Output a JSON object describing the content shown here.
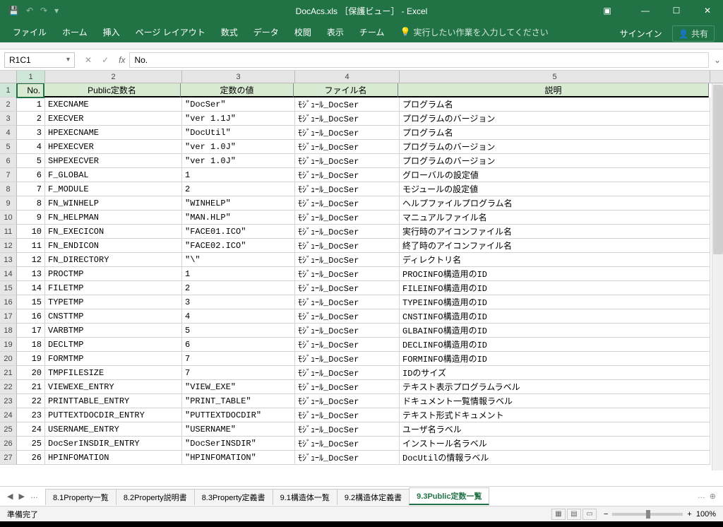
{
  "title": "DocAcs.xls ［保護ビュー］ - Excel",
  "ribbonTabs": [
    "ファイル",
    "ホーム",
    "挿入",
    "ページ レイアウト",
    "数式",
    "データ",
    "校閲",
    "表示",
    "チーム"
  ],
  "tellme": "実行したい作業を入力してください",
  "signin": "サインイン",
  "share": "共有",
  "nameBox": "R1C1",
  "fxValue": "No.",
  "colHeaders": [
    "1",
    "2",
    "3",
    "4",
    "5"
  ],
  "tableHeaders": [
    "No.",
    "Public定数名",
    "定数の値",
    "ファイル名",
    "説明"
  ],
  "rows": [
    {
      "n": "1",
      "name": "EXECNAME",
      "val": "\"DocSer\"",
      "file": "ﾓｼﾞｭｰﾙ_DocSer",
      "desc": "プログラム名"
    },
    {
      "n": "2",
      "name": "EXECVER",
      "val": "\"ver 1.1J\"",
      "file": "ﾓｼﾞｭｰﾙ_DocSer",
      "desc": "プログラムのバージョン"
    },
    {
      "n": "3",
      "name": "HPEXECNAME",
      "val": "\"DocUtil\"",
      "file": "ﾓｼﾞｭｰﾙ_DocSer",
      "desc": "プログラム名"
    },
    {
      "n": "4",
      "name": "HPEXECVER",
      "val": "\"ver 1.0J\"",
      "file": "ﾓｼﾞｭｰﾙ_DocSer",
      "desc": "プログラムのバージョン"
    },
    {
      "n": "5",
      "name": "SHPEXECVER",
      "val": "\"ver 1.0J\"",
      "file": "ﾓｼﾞｭｰﾙ_DocSer",
      "desc": "プログラムのバージョン"
    },
    {
      "n": "6",
      "name": "F_GLOBAL",
      "val": "1",
      "file": "ﾓｼﾞｭｰﾙ_DocSer",
      "desc": "グローバルの設定値"
    },
    {
      "n": "7",
      "name": "F_MODULE",
      "val": "2",
      "file": "ﾓｼﾞｭｰﾙ_DocSer",
      "desc": "モジュールの設定値"
    },
    {
      "n": "8",
      "name": "FN_WINHELP",
      "val": "\"WINHELP\"",
      "file": "ﾓｼﾞｭｰﾙ_DocSer",
      "desc": "ヘルプファイルプログラム名"
    },
    {
      "n": "9",
      "name": "FN_HELPMAN",
      "val": "\"MAN.HLP\"",
      "file": "ﾓｼﾞｭｰﾙ_DocSer",
      "desc": "マニュアルファイル名"
    },
    {
      "n": "10",
      "name": "FN_EXECICON",
      "val": "\"FACE01.ICO\"",
      "file": "ﾓｼﾞｭｰﾙ_DocSer",
      "desc": "実行時のアイコンファイル名"
    },
    {
      "n": "11",
      "name": "FN_ENDICON",
      "val": "\"FACE02.ICO\"",
      "file": "ﾓｼﾞｭｰﾙ_DocSer",
      "desc": "終了時のアイコンファイル名"
    },
    {
      "n": "12",
      "name": "FN_DIRECTORY",
      "val": "\"\\\"",
      "file": "ﾓｼﾞｭｰﾙ_DocSer",
      "desc": "ディレクトリ名"
    },
    {
      "n": "13",
      "name": "PROCTMP",
      "val": "1",
      "file": "ﾓｼﾞｭｰﾙ_DocSer",
      "desc": "PROCINFO構造用のID"
    },
    {
      "n": "14",
      "name": "FILETMP",
      "val": "2",
      "file": "ﾓｼﾞｭｰﾙ_DocSer",
      "desc": "FILEINFO構造用のID"
    },
    {
      "n": "15",
      "name": "TYPETMP",
      "val": "3",
      "file": "ﾓｼﾞｭｰﾙ_DocSer",
      "desc": "TYPEINFO構造用のID"
    },
    {
      "n": "16",
      "name": "CNSTTMP",
      "val": "4",
      "file": "ﾓｼﾞｭｰﾙ_DocSer",
      "desc": "CNSTINFO構造用のID"
    },
    {
      "n": "17",
      "name": "VARBTMP",
      "val": "5",
      "file": "ﾓｼﾞｭｰﾙ_DocSer",
      "desc": "GLBAINFO構造用のID"
    },
    {
      "n": "18",
      "name": "DECLTMP",
      "val": "6",
      "file": "ﾓｼﾞｭｰﾙ_DocSer",
      "desc": "DECLINFO構造用のID"
    },
    {
      "n": "19",
      "name": "FORMTMP",
      "val": "7",
      "file": "ﾓｼﾞｭｰﾙ_DocSer",
      "desc": "FORMINFO構造用のID"
    },
    {
      "n": "20",
      "name": "TMPFILESIZE",
      "val": "7",
      "file": "ﾓｼﾞｭｰﾙ_DocSer",
      "desc": "IDのサイズ"
    },
    {
      "n": "21",
      "name": "VIEWEXE_ENTRY",
      "val": "\"VIEW_EXE\"",
      "file": "ﾓｼﾞｭｰﾙ_DocSer",
      "desc": "テキスト表示プログラムラベル"
    },
    {
      "n": "22",
      "name": "PRINTTABLE_ENTRY",
      "val": "\"PRINT_TABLE\"",
      "file": "ﾓｼﾞｭｰﾙ_DocSer",
      "desc": "ドキュメント一覧情報ラベル"
    },
    {
      "n": "23",
      "name": "PUTTEXTDOCDIR_ENTRY",
      "val": "\"PUTTEXTDOCDIR\"",
      "file": "ﾓｼﾞｭｰﾙ_DocSer",
      "desc": "テキスト形式ドキュメント"
    },
    {
      "n": "24",
      "name": "USERNAME_ENTRY",
      "val": "\"USERNAME\"",
      "file": "ﾓｼﾞｭｰﾙ_DocSer",
      "desc": "ユーザ名ラベル"
    },
    {
      "n": "25",
      "name": "DocSerINSDIR_ENTRY",
      "val": "\"DocSerINSDIR\"",
      "file": "ﾓｼﾞｭｰﾙ_DocSer",
      "desc": "インストール名ラベル"
    },
    {
      "n": "26",
      "name": "HPINFOMATION",
      "val": "\"HPINFOMATION\"",
      "file": "ﾓｼﾞｭｰﾙ_DocSer",
      "desc": "DocUtilの情報ラベル"
    }
  ],
  "sheetTabs": [
    "8.1Property一覧",
    "8.2Property説明書",
    "8.3Property定義書",
    "9.1構造体一覧",
    "9.2構造体定義書",
    "9.3Public定数一覧"
  ],
  "activeSheet": 5,
  "status": "準備完了",
  "zoom": "100%"
}
